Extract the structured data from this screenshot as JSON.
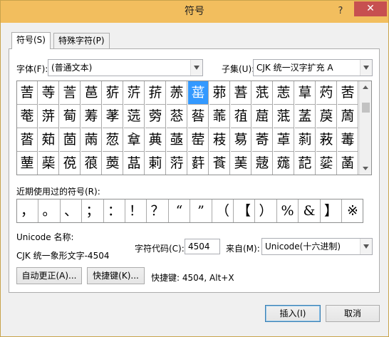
{
  "window": {
    "title": "符号",
    "help_glyph": "?",
    "close_glyph": "✕"
  },
  "tabs": [
    {
      "label": "符号(S)"
    },
    {
      "label": "特殊字符(P)"
    }
  ],
  "font": {
    "label": "字体(F):",
    "value": "(普通文本)"
  },
  "subset": {
    "label": "子集(U):",
    "value": "CJK 统一汉字扩充 A"
  },
  "symbol_grid": {
    "selected": "䔄",
    "rows": [
      [
        "䓀",
        "䓁",
        "䓂",
        "䓃",
        "䓄",
        "䓅",
        "䓆",
        "䓇",
        "䔄",
        "䓉",
        "䓊",
        "䓋",
        "䓌",
        "䓍",
        "䓎",
        "䓏"
      ],
      [
        "䓐",
        "䓑",
        "䓒",
        "䓓",
        "䓔",
        "䓕",
        "䓖",
        "䓗",
        "䓘",
        "䓙",
        "䓚",
        "䓛",
        "䓜",
        "䓝",
        "䓞",
        "䓟"
      ],
      [
        "䓠",
        "䓡",
        "䓢",
        "䓣",
        "䓤",
        "䓥",
        "䓦",
        "䓧",
        "䓨",
        "䓩",
        "䓪",
        "䓫",
        "䓬",
        "䓭",
        "䓮",
        "䓯"
      ],
      [
        "䓰",
        "䓱",
        "䓲",
        "䓳",
        "䓴",
        "䓵",
        "䓶",
        "䓷",
        "䓸",
        "䓹",
        "䓺",
        "䓻",
        "䓼",
        "䓽",
        "䓾",
        "䓿"
      ]
    ]
  },
  "recent": {
    "label": "近期使用过的符号(R):",
    "symbols": [
      "，",
      "。",
      "、",
      "；",
      "：",
      "！",
      "？",
      "“",
      "”",
      "（",
      "【",
      "）",
      "%",
      "&",
      "】",
      "※"
    ]
  },
  "unicode_name": {
    "label": "Unicode 名称:",
    "value": "CJK 统一象形文字-4504"
  },
  "char_code": {
    "label": "字符代码(C):",
    "value": "4504"
  },
  "from": {
    "label": "来自(M):",
    "value": "Unicode(十六进制)"
  },
  "buttons": {
    "autocorrect": "自动更正(A)...",
    "shortcut_key": "快捷键(K)...",
    "insert": "插入(I)",
    "cancel": "取消"
  },
  "shortcut_text": "快捷键: 4504, Alt+X",
  "colors": {
    "titlebar": "#f2be5e",
    "close": "#c75050",
    "selection": "#3399ff"
  }
}
